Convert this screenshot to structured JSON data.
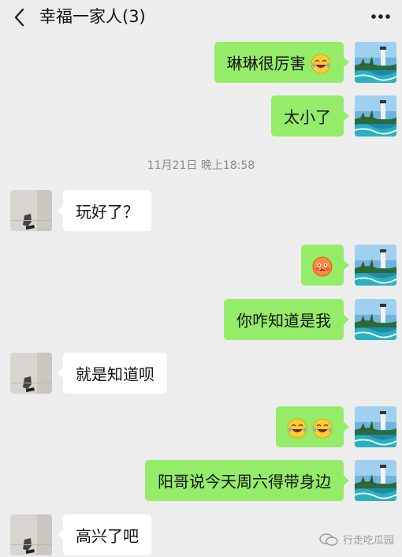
{
  "header": {
    "title": "幸福一家人(3)",
    "back_icon": "chevron-left-icon",
    "more_icon": "more-dots-icon"
  },
  "messages": [
    {
      "side": "right",
      "text": "琳琳很厉害",
      "emoji": [
        "laugh-cry-emoji"
      ]
    },
    {
      "side": "right",
      "text": "太小了"
    },
    {
      "side": "left",
      "text": "玩好了？"
    },
    {
      "side": "right",
      "text": "",
      "emoji": [
        "blush-emoji"
      ]
    },
    {
      "side": "right",
      "text": "你咋知道是我"
    },
    {
      "side": "left",
      "text": "就是知道呗"
    },
    {
      "side": "right",
      "text": "",
      "emoji": [
        "laugh-cry-emoji",
        "laugh-cry-emoji"
      ]
    },
    {
      "side": "right",
      "text": "阳哥说今天周六得带身边"
    },
    {
      "side": "left",
      "text": "高兴了吧"
    }
  ],
  "timestamp": "11月21日 晚上18:58",
  "watermark": "行走吃瓜园",
  "colors": {
    "background": "#ededed",
    "bubble_me": "#95ec69",
    "bubble_other": "#ffffff",
    "timestamp": "#8a8a8a"
  }
}
